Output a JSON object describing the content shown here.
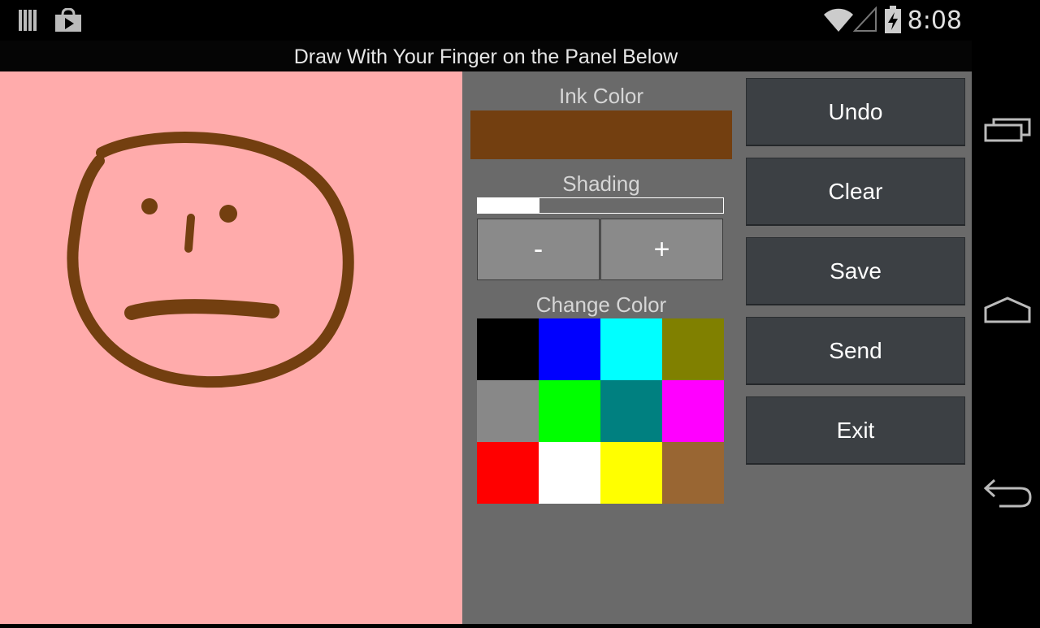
{
  "status_bar": {
    "time": "8:08",
    "icons": [
      "notification-icon",
      "play-store-icon",
      "wifi-icon",
      "signal-icon",
      "battery-charging-icon"
    ]
  },
  "header": {
    "title": "Draw With Your Finger on the Panel Below"
  },
  "controls": {
    "ink_color_label": "Ink Color",
    "ink_color": "#733f10",
    "shading_label": "Shading",
    "shading_level": 0.25,
    "minus_label": "-",
    "plus_label": "+",
    "change_color_label": "Change Color",
    "palette": [
      "#000000",
      "#0000ff",
      "#00ffff",
      "#808000",
      "#888888",
      "#00ff00",
      "#008080",
      "#ff00ff",
      "#ff0000",
      "#ffffff",
      "#ffff00",
      "#996633"
    ]
  },
  "actions": {
    "undo": "Undo",
    "clear": "Clear",
    "save": "Save",
    "send": "Send",
    "exit": "Exit"
  },
  "colors": {
    "canvas_bg": "#ffabab",
    "panel_bg": "#6a6a6a",
    "button_bg": "#3c4044"
  },
  "nav_icons": [
    "recent-apps-icon",
    "home-icon",
    "back-icon"
  ]
}
